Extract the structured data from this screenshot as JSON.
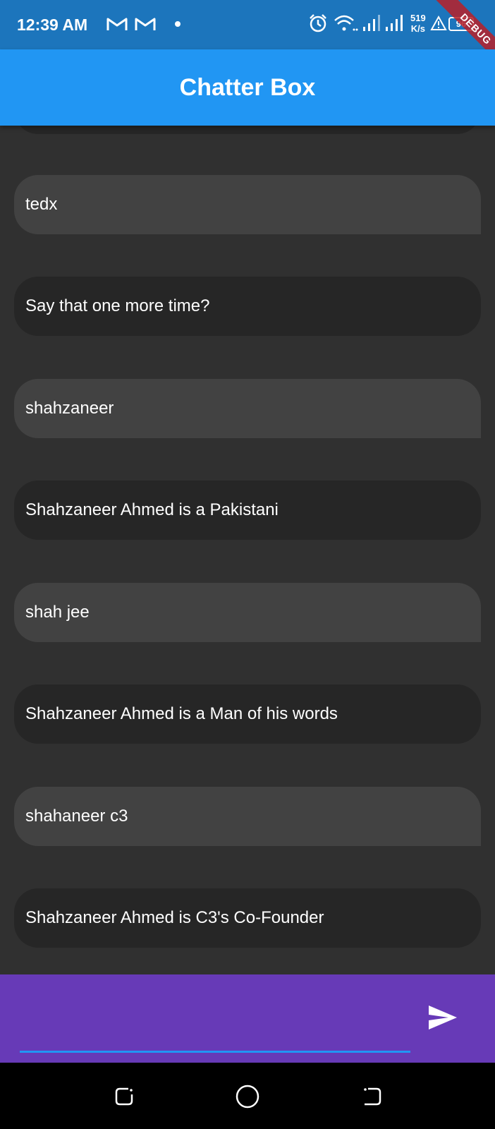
{
  "status_bar": {
    "time": "12:39 AM",
    "left_icons": [
      "gmail-icon",
      "gmail-icon",
      "notification-dot-icon"
    ],
    "right_icons": [
      "alarm-icon",
      "wifi-icon",
      "signal-icon",
      "signal-icon",
      "warning-icon"
    ],
    "net_speed_value": "519",
    "net_speed_unit": "K/s",
    "battery": "96",
    "color": "#1c75bc"
  },
  "debug_banner": "DEBUG",
  "app_bar": {
    "title": "Chatter Box",
    "color": "#2196f3"
  },
  "chat": {
    "background": "#303030",
    "messages": [
      {
        "role": "user",
        "text": "tedx"
      },
      {
        "role": "bot",
        "text": "Say that one more time?"
      },
      {
        "role": "user",
        "text": "shahzaneer"
      },
      {
        "role": "bot",
        "text": "Shahzaneer Ahmed is a Pakistani"
      },
      {
        "role": "user",
        "text": "shah jee"
      },
      {
        "role": "bot",
        "text": "Shahzaneer Ahmed is a Man of his words"
      },
      {
        "role": "user",
        "text": "shahaneer c3"
      },
      {
        "role": "bot",
        "text": "Shahzaneer Ahmed is C3's Co-Founder"
      }
    ]
  },
  "composer": {
    "value": "",
    "background": "#673ab7",
    "send_icon": "send-icon"
  },
  "nav_bar": {
    "buttons": [
      "recents-icon",
      "home-icon",
      "back-icon"
    ]
  }
}
